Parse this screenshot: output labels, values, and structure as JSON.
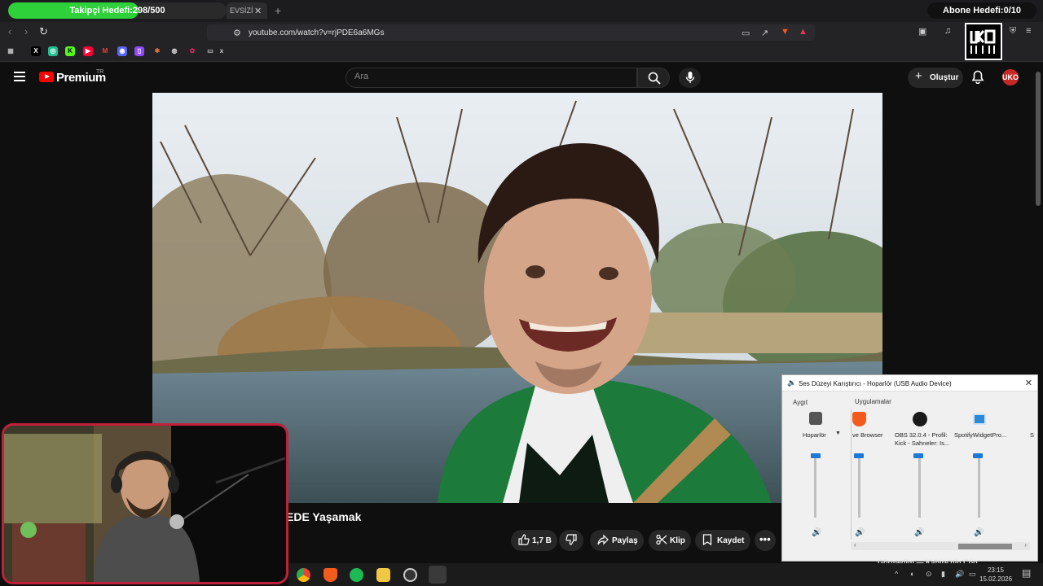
{
  "overlay": {
    "follower_goal_label": "Takipçi Hedefi:298/500",
    "follower_goal_progress": 0.596,
    "subscriber_goal_label": "Abone Hedefi:0/10"
  },
  "browser": {
    "tab_title": "EVSİZİ",
    "url": "youtube.com/watch?v=rjPDE6a6MGs"
  },
  "youtube": {
    "brand": "Premium",
    "region": "TR",
    "search_placeholder": "Ara",
    "create_label": "Oluştur",
    "avatar_text": "UKO",
    "video_title": "EDE Yaşamak",
    "like_count": "1,7 B",
    "share_label": "Paylaş",
    "clip_label": "Klip",
    "save_label": "Kaydet"
  },
  "mixer": {
    "title": "Ses Düzeyi Karıştırıcı - Hoparlör (USB Audio Device)",
    "device_header": "Aygıt",
    "apps_header": "Uygulamalar",
    "channels": [
      {
        "name": "Hoparlör",
        "level": 0.95,
        "icon": "speaker-device-icon"
      },
      {
        "name": "ve Browser",
        "level": 0.95,
        "icon": "brave-icon"
      },
      {
        "name": "OBS 32.0.4 - Profil: Kick - Sahneler: Is...",
        "level": 0.95,
        "icon": "obs-icon"
      },
      {
        "name": "SpotifyWidgetPro...",
        "level": 0.95,
        "icon": "spotify-widget-icon"
      },
      {
        "name": "S",
        "level": 0.95,
        "icon": "app-icon"
      }
    ]
  },
  "taskbar": {
    "time": "23:15",
    "date": "15.02.2026"
  },
  "peek": {
    "text": "Görmedim — Kahire'nin Çöp..."
  }
}
